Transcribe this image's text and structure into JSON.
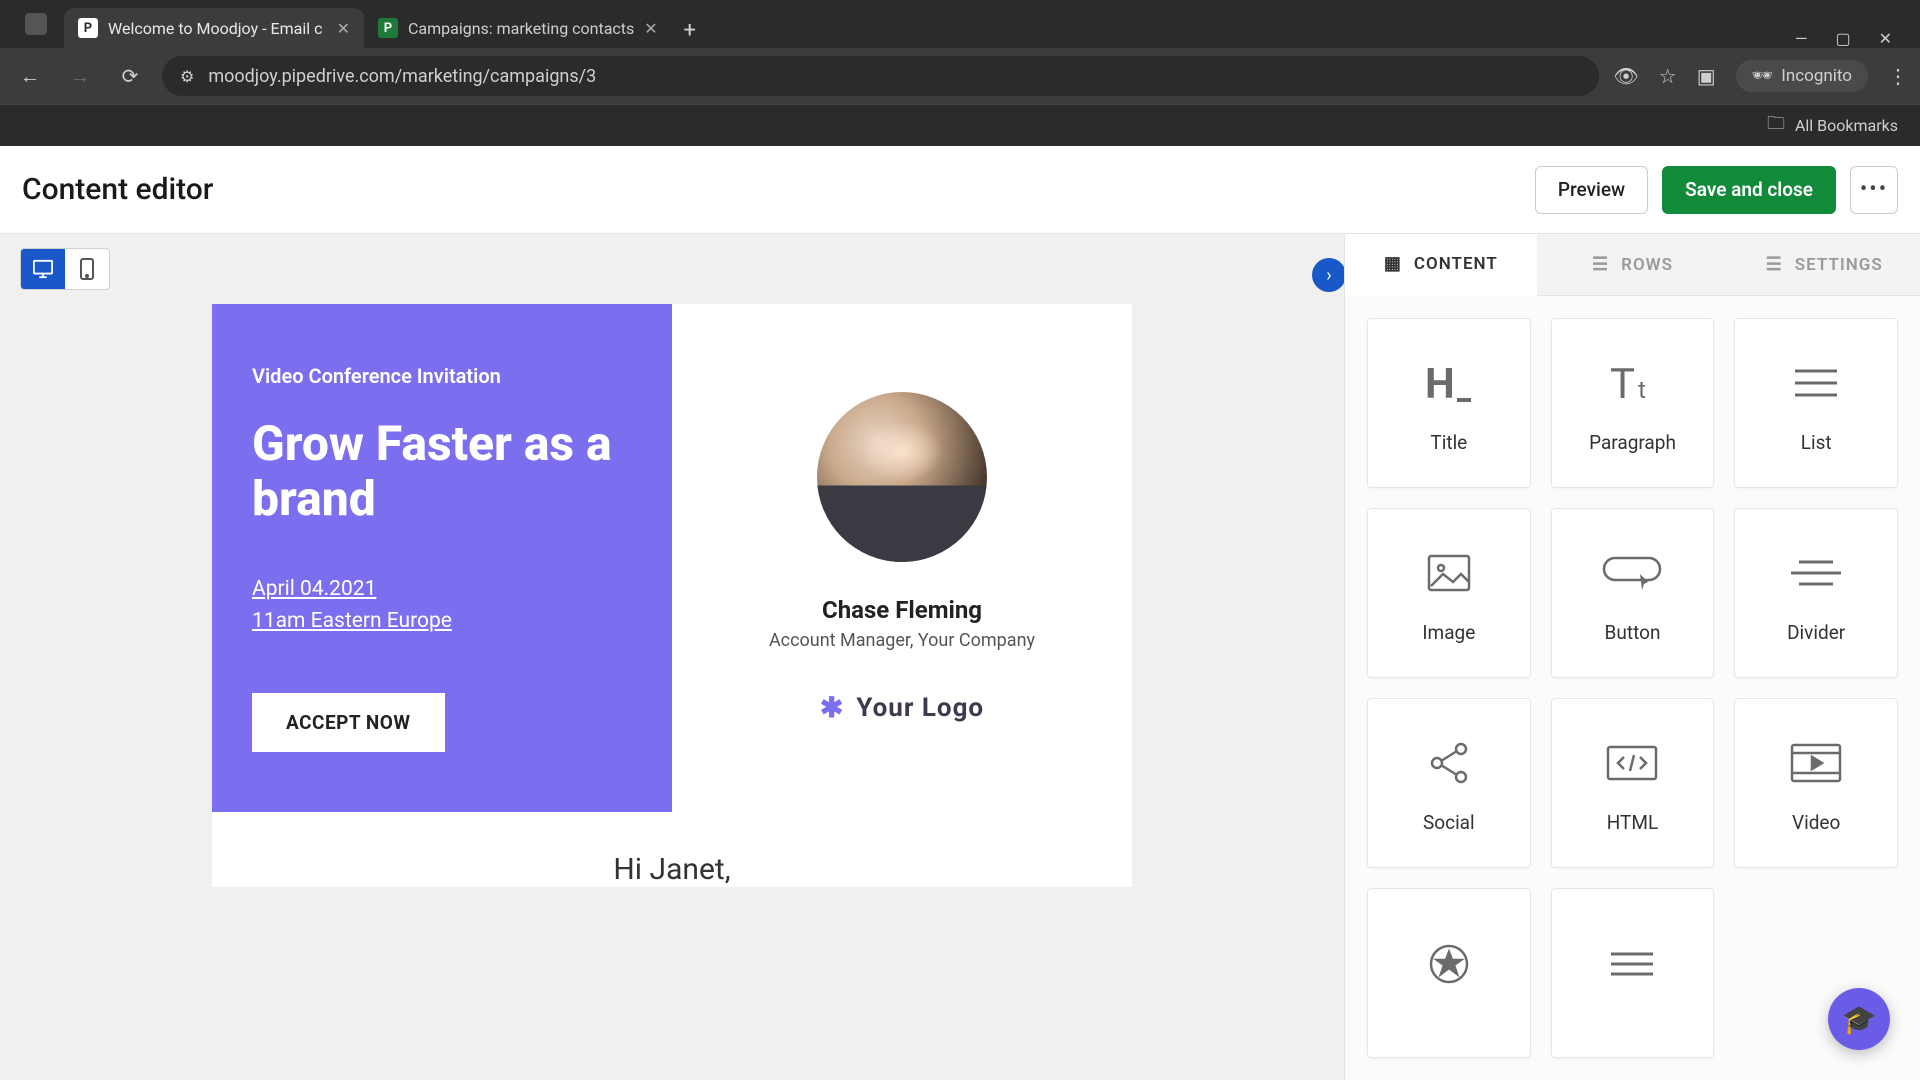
{
  "browser": {
    "tabs": [
      {
        "title": "Welcome to Moodjoy - Email c",
        "faviconLetter": "P",
        "faviconStyle": "white"
      },
      {
        "title": "Campaigns: marketing contacts",
        "faviconLetter": "P",
        "faviconStyle": "green"
      }
    ],
    "url": "moodjoy.pipedrive.com/marketing/campaigns/3",
    "incognitoLabel": "Incognito",
    "allBookmarks": "All Bookmarks"
  },
  "header": {
    "title": "Content editor",
    "previewLabel": "Preview",
    "saveLabel": "Save and close"
  },
  "sidebar": {
    "tabs": {
      "content": "CONTENT",
      "rows": "ROWS",
      "settings": "SETTINGS"
    },
    "blocks": {
      "title": "Title",
      "paragraph": "Paragraph",
      "list": "List",
      "image": "Image",
      "button": "Button",
      "divider": "Divider",
      "social": "Social",
      "html": "HTML",
      "video": "Video"
    }
  },
  "email": {
    "kicker": "Video Conference Invitation",
    "headline": "Grow Faster as a brand",
    "dateLine": "April 04.2021",
    "timeLine": "11am Eastern Europe",
    "cta": "ACCEPT NOW",
    "personName": "Chase Fleming",
    "personRole": "Account Manager, Your Company",
    "logoText": "Your Logo",
    "greeting": "Hi Janet,"
  }
}
